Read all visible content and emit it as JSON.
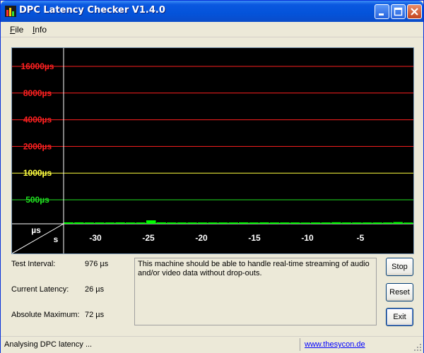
{
  "window": {
    "title": "DPC Latency Checker V1.4.0",
    "icon": "bar-chart-app-icon",
    "controls": [
      "minimize-icon",
      "maximize-icon",
      "close-icon"
    ]
  },
  "menu": {
    "items": [
      {
        "label": "File",
        "mnemonic": "F"
      },
      {
        "label": "Info",
        "mnemonic": "I"
      }
    ]
  },
  "chart_data": {
    "type": "bar",
    "title": "",
    "xlabel": "s",
    "ylabel": "µs",
    "yscale": "log",
    "y_gridlines": [
      {
        "label": "16000µs",
        "value": 16000,
        "color": "#FF2020"
      },
      {
        "label": "8000µs",
        "value": 8000,
        "color": "#FF2020"
      },
      {
        "label": "4000µs",
        "value": 4000,
        "color": "#FF2020"
      },
      {
        "label": "2000µs",
        "value": 2000,
        "color": "#FF2020"
      },
      {
        "label": "1000µs",
        "value": 1000,
        "color": "#FFFF40"
      },
      {
        "label": "500µs",
        "value": 500,
        "color": "#20E020"
      }
    ],
    "x_ticks": [
      "-30",
      "-25",
      "-20",
      "-15",
      "-10",
      "-5"
    ],
    "xlim": [
      -33,
      0
    ],
    "bar_color": "#00FF00",
    "categories": [
      "-33",
      "-32",
      "-31",
      "-30",
      "-29",
      "-28",
      "-27",
      "-26",
      "-25",
      "-24",
      "-23",
      "-22",
      "-21",
      "-20",
      "-19",
      "-18",
      "-17",
      "-16",
      "-15",
      "-14",
      "-13",
      "-12",
      "-11",
      "-10",
      "-9",
      "-8",
      "-7",
      "-6",
      "-5",
      "-4",
      "-3",
      "-2",
      "-1"
    ],
    "values": [
      30,
      30,
      28,
      28,
      28,
      30,
      28,
      28,
      72,
      30,
      28,
      28,
      28,
      28,
      28,
      28,
      28,
      30,
      28,
      30,
      28,
      28,
      28,
      26,
      28,
      28,
      32,
      28,
      28,
      28,
      28,
      28,
      36,
      26
    ]
  },
  "stats": {
    "test_interval_label": "Test Interval:",
    "test_interval_value": "976 µs",
    "current_latency_label": "Current Latency:",
    "current_latency_value": "26 µs",
    "absolute_maximum_label": "Absolute Maximum:",
    "absolute_maximum_value": "72 µs"
  },
  "message": "This machine should be able to handle real-time streaming of audio and/or video data without drop-outs.",
  "buttons": {
    "stop": "Stop",
    "reset": "Reset",
    "exit": "Exit"
  },
  "status": {
    "text": "Analysing DPC latency ...",
    "link": "www.thesycon.de"
  }
}
